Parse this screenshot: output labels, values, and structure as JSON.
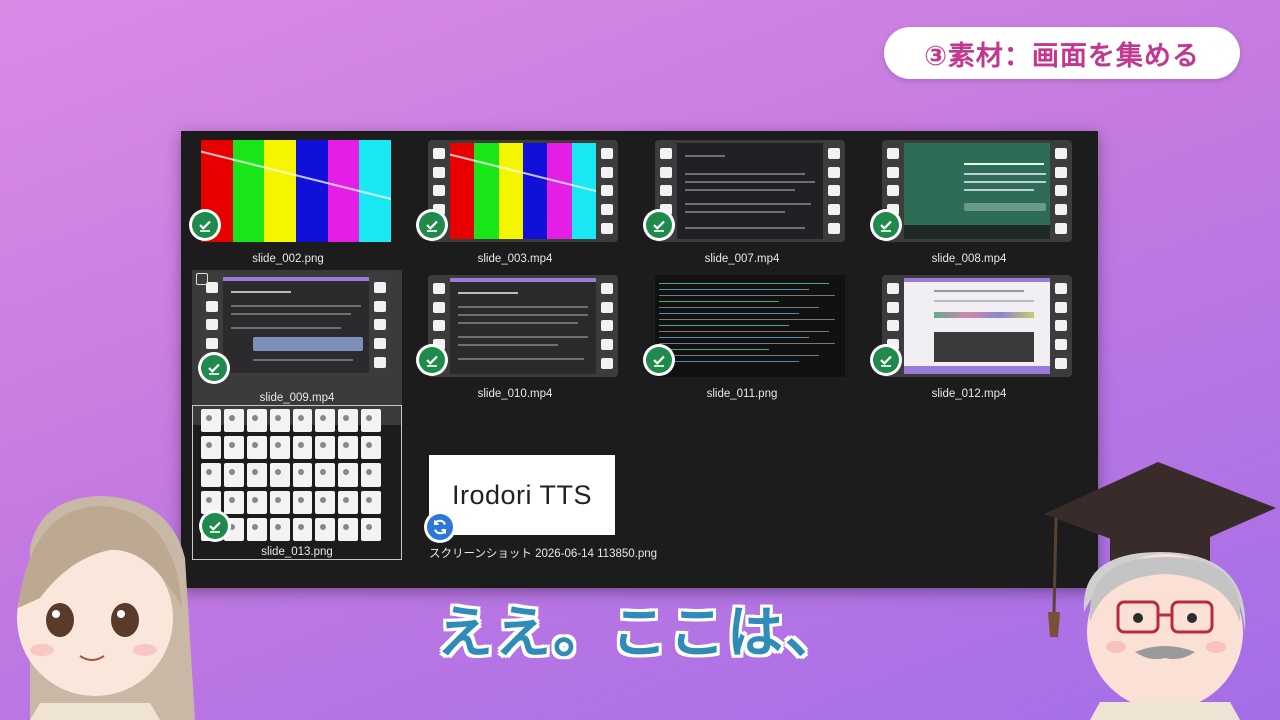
{
  "topic_badge": "③素材：画面を集める",
  "subtitle": "ええ。ここは、",
  "colors": {
    "check_green": "#1f8a4c",
    "sync_blue": "#2b78d8",
    "accent_pink": "#c2378f",
    "subtitle_blue": "#2f8bb8",
    "window_bg": "#1c1c1c"
  },
  "files": [
    {
      "name": "slide_002.png",
      "type": "image",
      "status": "check-icon"
    },
    {
      "name": "slide_003.mp4",
      "type": "video",
      "status": "check-icon"
    },
    {
      "name": "slide_007.mp4",
      "type": "video",
      "status": "check-icon"
    },
    {
      "name": "slide_008.mp4",
      "type": "video",
      "status": "check-icon"
    },
    {
      "name": "slide_009.mp4",
      "type": "video",
      "status": "check-icon",
      "selected": true
    },
    {
      "name": "slide_010.mp4",
      "type": "video",
      "status": "check-icon"
    },
    {
      "name": "slide_011.png",
      "type": "image",
      "status": "check-icon"
    },
    {
      "name": "slide_012.mp4",
      "type": "video",
      "status": "check-icon"
    },
    {
      "name": "slide_013.png",
      "type": "image",
      "status": "check-icon",
      "focused": true
    },
    {
      "name": "スクリーンショット 2026-06-14 113850.png",
      "type": "image",
      "status": "sync-icon",
      "thumb_text": "Irodori TTS"
    }
  ]
}
